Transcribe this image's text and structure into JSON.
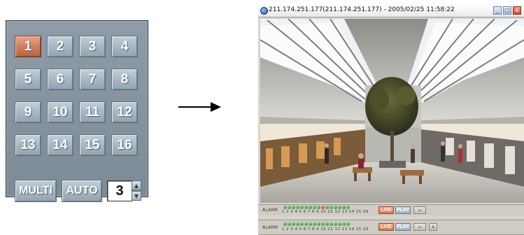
{
  "panel": {
    "channels": [
      "1",
      "2",
      "3",
      "4",
      "5",
      "6",
      "7",
      "8",
      "9",
      "10",
      "11",
      "12",
      "13",
      "14",
      "15",
      "16"
    ],
    "active_channel": "1",
    "multi_label": "MULTI",
    "auto_label": "AUTO",
    "split_value": "3",
    "spin_up_glyph": "▲",
    "spin_down_glyph": "▼"
  },
  "arrow": {
    "icon": "right-arrow-icon"
  },
  "viewer": {
    "title": "211.174.251.177(211.174.251.177) - 2005/02/25 11:58:22",
    "window_buttons": {
      "minimize": "_",
      "maximize": "□",
      "close": "x"
    },
    "status_bar": {
      "alarm_label": "ALARM",
      "alarm_numbers": "1 2 3 4 5 6 7 8 9 10 11 12 13 14 15 16",
      "alarm_active_index": 9,
      "live_label": "LIVE",
      "play_label": "PLAY",
      "next_glyph": ">"
    },
    "status_bar2": {
      "alarm_label": "ALARM",
      "alarm_numbers": "1 2 3 4 5 6 7 8 9 10 11 12 13 14 15 16",
      "live_label": "LIVE",
      "play_label": "PLAY",
      "next_glyph": ">",
      "page_glyph": "4"
    }
  },
  "colors": {
    "panel_bg": "#8e9ca8",
    "active_button": "#cf7c5a",
    "led_green": "#2e9a2e",
    "led_red": "#c01818"
  }
}
